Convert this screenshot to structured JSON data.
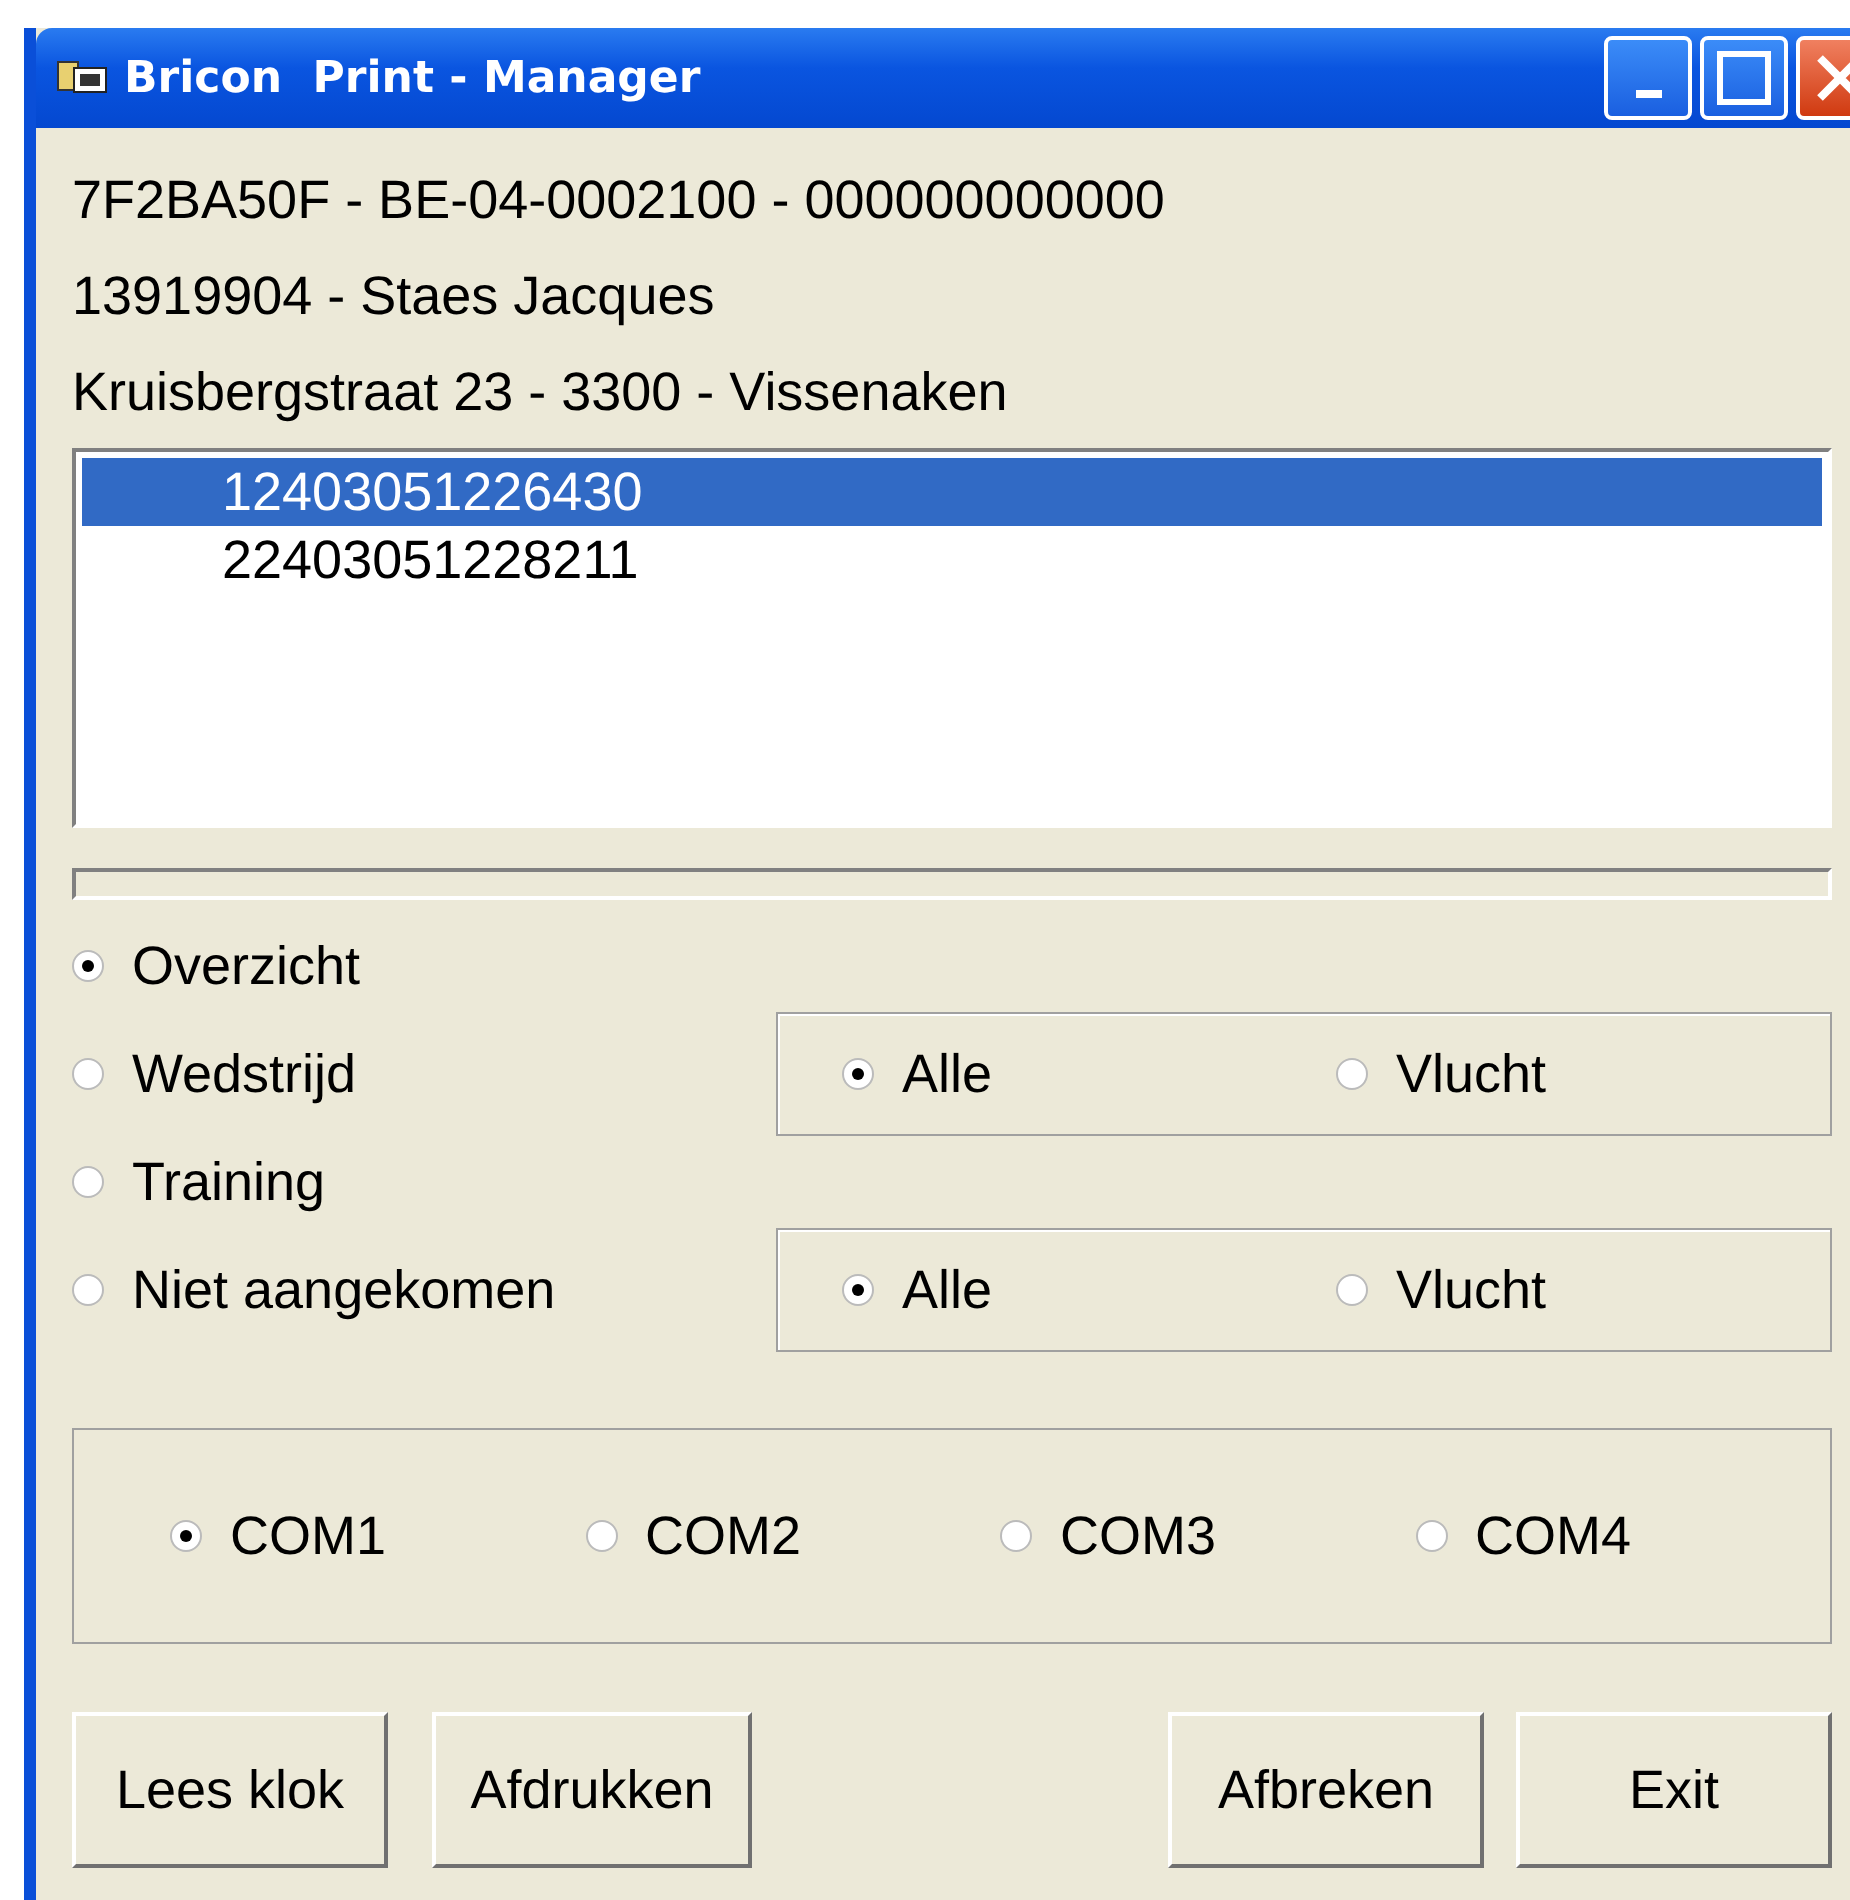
{
  "window": {
    "title": "Bricon  Print - Manager"
  },
  "header_lines": [
    "7F2BA50F - BE-04-0002100  - 000000000000",
    "13919904 - Staes Jacques",
    "Kruisbergstraat 23 - 3300 - Vissenaken"
  ],
  "list": {
    "items": [
      {
        "label": "12403051226430",
        "selected": true
      },
      {
        "label": "22403051228211",
        "selected": false
      }
    ]
  },
  "report_options": [
    {
      "label": "Overzicht",
      "selected": true
    },
    {
      "label": "Wedstrijd",
      "selected": false,
      "sub_options": [
        {
          "label": "Alle",
          "selected": true
        },
        {
          "label": "Vlucht",
          "selected": false
        }
      ]
    },
    {
      "label": "Training",
      "selected": false
    },
    {
      "label": "Niet aangekomen",
      "selected": false,
      "sub_options": [
        {
          "label": "Alle",
          "selected": true
        },
        {
          "label": "Vlucht",
          "selected": false
        }
      ]
    }
  ],
  "ports": [
    {
      "label": "COM1",
      "selected": true
    },
    {
      "label": "COM2",
      "selected": false
    },
    {
      "label": "COM3",
      "selected": false
    },
    {
      "label": "COM4",
      "selected": false
    }
  ],
  "buttons_left": [
    "Lees klok",
    "Afdrukken"
  ],
  "buttons_right": [
    "Afbreken",
    "Exit"
  ]
}
